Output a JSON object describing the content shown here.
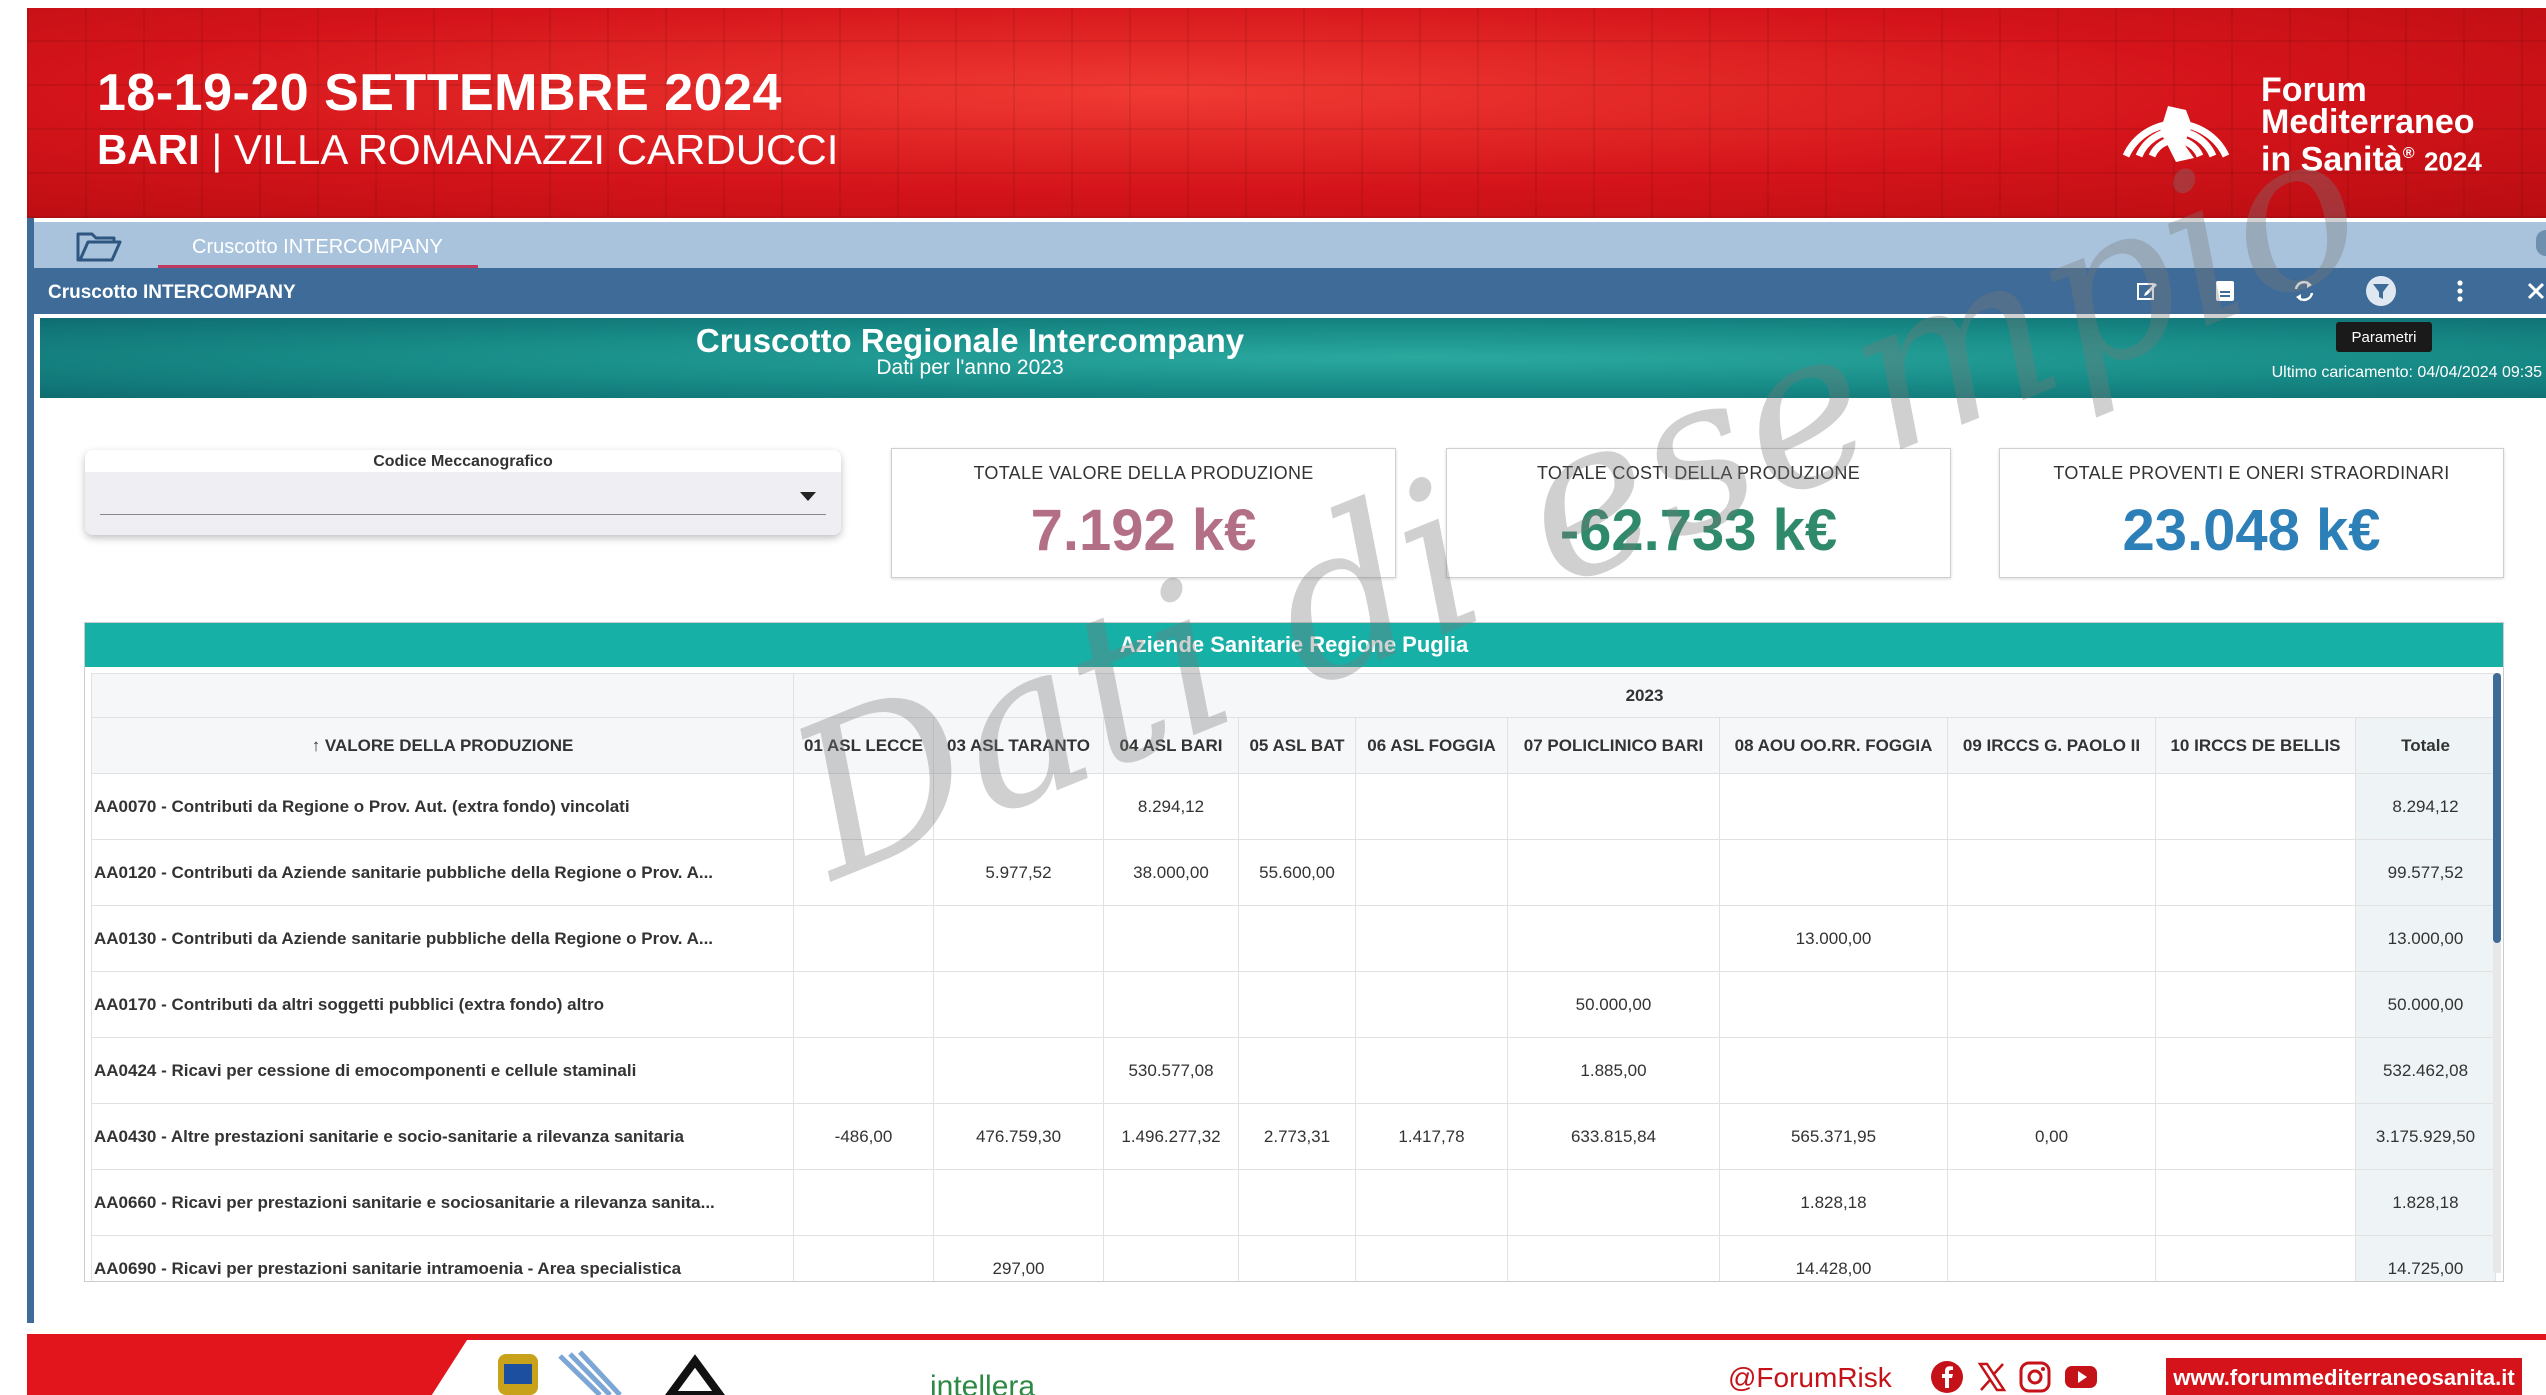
{
  "banner": {
    "date": "18-19-20 SETTEMBRE 2024",
    "city": "BARI",
    "separator": "|",
    "venue": "VILLA ROMANAZZI CARDUCCI",
    "brand_line1": "Forum",
    "brand_line2": "Mediterraneo",
    "brand_line3": "in Sanità",
    "brand_reg": "®",
    "brand_year": "2024"
  },
  "tabs": [
    {
      "label": "Cruscotto INTERCOMPANY"
    }
  ],
  "toolbar": {
    "title": "Cruscotto INTERCOMPANY",
    "icons": [
      "edit-icon",
      "save-icon",
      "refresh-icon",
      "filter-icon",
      "more-vertical-icon",
      "close-icon"
    ]
  },
  "tooltip": "Parametri",
  "dashboard": {
    "title": "Cruscotto Regionale Intercompany",
    "subtitle": "Dati per l'anno 2023",
    "last_load": "Ultimo caricamento: 04/04/2024 09:35"
  },
  "filter": {
    "label": "Codice Meccanografico",
    "value": ""
  },
  "kpis": [
    {
      "label": "TOTALE VALORE DELLA PRODUZIONE",
      "value": "7.192 k€",
      "color": "#b36f86"
    },
    {
      "label": "TOTALE COSTI DELLA PRODUZIONE",
      "value": "-62.733 k€",
      "color": "#2f8a6c"
    },
    {
      "label": "TOTALE PROVENTI E ONERI STRAORDINARI",
      "value": "23.048 k€",
      "color": "#2d7fb8"
    }
  ],
  "table": {
    "title": "Aziende Sanitarie Regione Puglia",
    "year": "2023",
    "row_header": "↑ VALORE DELLA PRODUZIONE",
    "columns": [
      "01 ASL LECCE",
      "03 ASL TARANTO",
      "04 ASL BARI",
      "05 ASL BAT",
      "06 ASL FOGGIA",
      "07 POLICLINICO BARI",
      "08 AOU OO.RR. FOGGIA",
      "09 IRCCS G. PAOLO II",
      "10 IRCCS DE BELLIS",
      "Totale"
    ],
    "rows": [
      {
        "label": "AA0070 - Contributi da Regione o Prov. Aut. (extra fondo) vincolati",
        "values": [
          "",
          "",
          "8.294,12",
          "",
          "",
          "",
          "",
          "",
          "",
          "8.294,12"
        ]
      },
      {
        "label": "AA0120 - Contributi da Aziende sanitarie pubbliche della Regione o Prov. A...",
        "values": [
          "",
          "5.977,52",
          "38.000,00",
          "55.600,00",
          "",
          "",
          "",
          "",
          "",
          "99.577,52"
        ]
      },
      {
        "label": "AA0130 - Contributi da Aziende sanitarie pubbliche della Regione o Prov. A...",
        "values": [
          "",
          "",
          "",
          "",
          "",
          "",
          "13.000,00",
          "",
          "",
          "13.000,00"
        ]
      },
      {
        "label": "AA0170 - Contributi da altri soggetti pubblici (extra fondo) altro",
        "values": [
          "",
          "",
          "",
          "",
          "",
          "50.000,00",
          "",
          "",
          "",
          "50.000,00"
        ]
      },
      {
        "label": "AA0424 - Ricavi per cessione di emocomponenti e cellule staminali",
        "values": [
          "",
          "",
          "530.577,08",
          "",
          "",
          "1.885,00",
          "",
          "",
          "",
          "532.462,08"
        ]
      },
      {
        "label": "AA0430 - Altre prestazioni sanitarie e socio-sanitarie a rilevanza sanitaria",
        "values": [
          "-486,00",
          "476.759,30",
          "1.496.277,32",
          "2.773,31",
          "1.417,78",
          "633.815,84",
          "565.371,95",
          "0,00",
          "",
          "3.175.929,50"
        ]
      },
      {
        "label": "AA0660 - Ricavi per prestazioni sanitarie e sociosanitarie a rilevanza sanita...",
        "values": [
          "",
          "",
          "",
          "",
          "",
          "",
          "1.828,18",
          "",
          "",
          "1.828,18"
        ]
      },
      {
        "label": "AA0690 - Ricavi per prestazioni sanitarie intramoenia - Area specialistica",
        "values": [
          "",
          "297,00",
          "",
          "",
          "",
          "",
          "14.428,00",
          "",
          "",
          "14.725,00"
        ]
      }
    ]
  },
  "watermark": "Dati di esempio",
  "footer": {
    "intellera": "intellera",
    "handle": "@ForumRisk",
    "social": [
      "facebook-icon",
      "x-icon",
      "instagram-icon",
      "youtube-icon"
    ],
    "url": "www.forummediterraneosanita.it"
  }
}
